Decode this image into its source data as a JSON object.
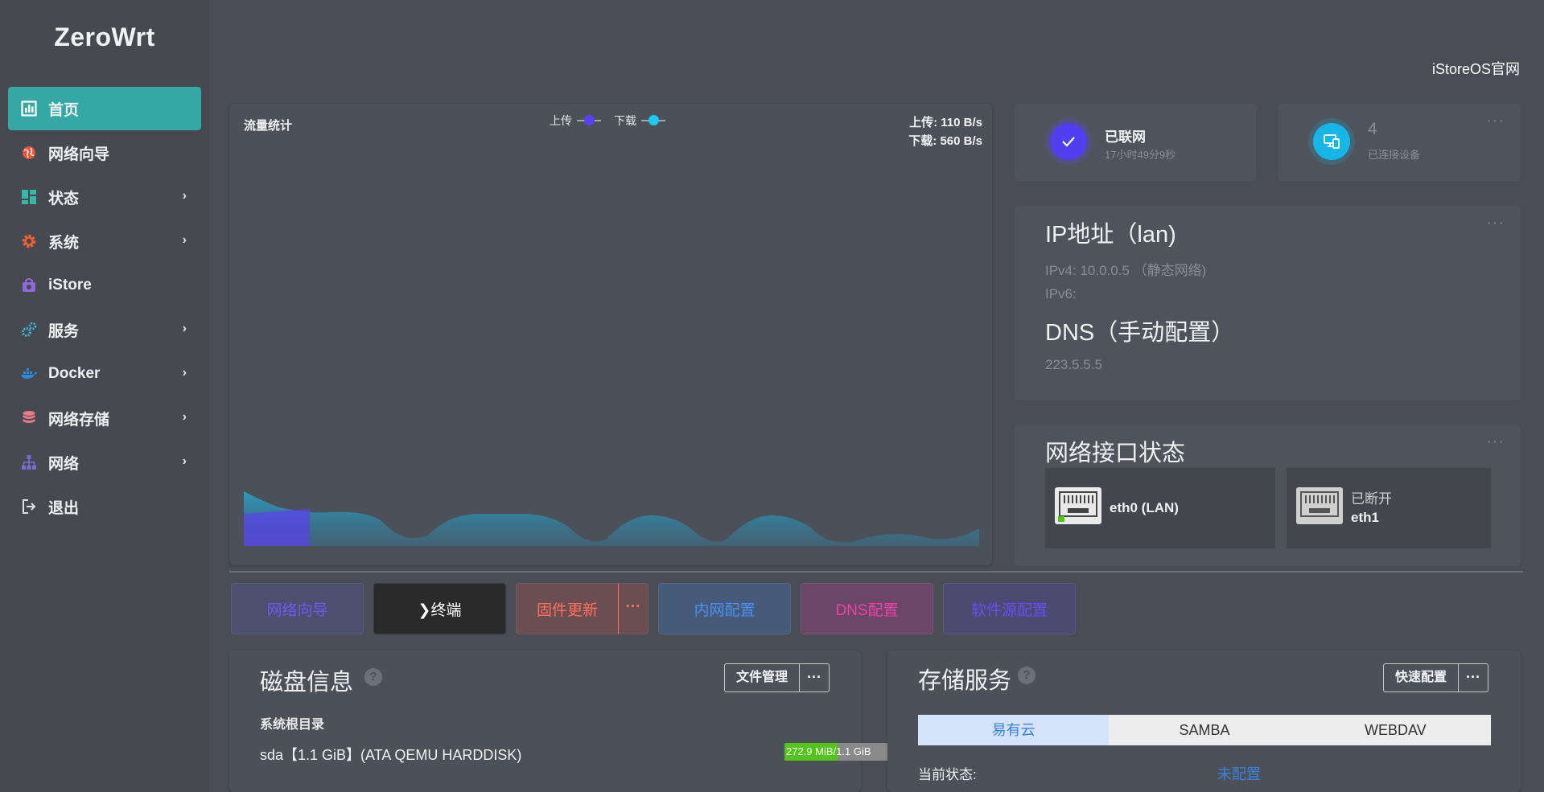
{
  "brand": "ZeroWrt",
  "top_link": "iStoreOS官网",
  "sidebar": {
    "items": [
      {
        "label": "首页",
        "icon": "dashboard-icon",
        "active": true,
        "has_children": false,
        "color": "#ffffff"
      },
      {
        "label": "网络向导",
        "icon": "globe-icon",
        "active": false,
        "has_children": false,
        "color": "#e8553f"
      },
      {
        "label": "状态",
        "icon": "grid-icon",
        "active": false,
        "has_children": true,
        "color": "#3ab5a8"
      },
      {
        "label": "系统",
        "icon": "gear-icon",
        "active": false,
        "has_children": true,
        "color": "#f06030"
      },
      {
        "label": "iStore",
        "icon": "store-icon",
        "active": false,
        "has_children": false,
        "color": "#8d6bd8"
      },
      {
        "label": "服务",
        "icon": "cogs-icon",
        "active": false,
        "has_children": true,
        "color": "#3bb8d8"
      },
      {
        "label": "Docker",
        "icon": "docker-icon",
        "active": false,
        "has_children": true,
        "color": "#2d8bd8"
      },
      {
        "label": "网络存储",
        "icon": "database-icon",
        "active": false,
        "has_children": true,
        "color": "#e87a8a"
      },
      {
        "label": "网络",
        "icon": "network-icon",
        "active": false,
        "has_children": true,
        "color": "#7a6bd8"
      },
      {
        "label": "退出",
        "icon": "logout-icon",
        "active": false,
        "has_children": false,
        "color": "#e0e0e0"
      }
    ],
    "chevron": "›"
  },
  "traffic": {
    "title": "流量统计",
    "legend_upload": "上传",
    "legend_download": "下载",
    "upload_rate": "上传: 110 B/s",
    "download_rate": "下载: 560 B/s",
    "upload_color": "#5b3ff0",
    "download_color": "#1ec8f0"
  },
  "connection": {
    "title": "已联网",
    "uptime": "17小时49分9秒"
  },
  "devices": {
    "count": "4",
    "label": "已连接设备"
  },
  "ip": {
    "title": "IP地址（lan)",
    "ipv4": "IPv4: 10.0.0.5 （静态网络)",
    "ipv6": "IPv6:",
    "dns_title": "DNS（手动配置）",
    "dns": "223.5.5.5"
  },
  "interfaces": {
    "title": "网络接口状态",
    "items": [
      {
        "name": "eth0 (LAN)",
        "status": "",
        "connected": true
      },
      {
        "name": "eth1",
        "status": "已断开",
        "connected": false
      }
    ]
  },
  "actions": {
    "wizard": "网络向导",
    "terminal": "❯终端",
    "firmware": "固件更新",
    "firmware_more": "···",
    "lan": "内网配置",
    "dns": "DNS配置",
    "source": "软件源配置"
  },
  "disk": {
    "title": "磁盘信息",
    "help": "?",
    "file_button": "文件管理",
    "more": "···",
    "section": "系统根目录",
    "device": "sda【1.1 GiB】(ATA QEMU HARDDISK)",
    "usage_text": "272.9 MiB/1.1 GiB",
    "usage_fraction": 0.23
  },
  "storage": {
    "title": "存储服务",
    "help": "?",
    "quick_button": "快速配置",
    "more": "···",
    "tabs": [
      "易有云",
      "SAMBA",
      "WEBDAV"
    ],
    "status_label": "当前状态:",
    "status_value": "未配置"
  },
  "dots": "···"
}
